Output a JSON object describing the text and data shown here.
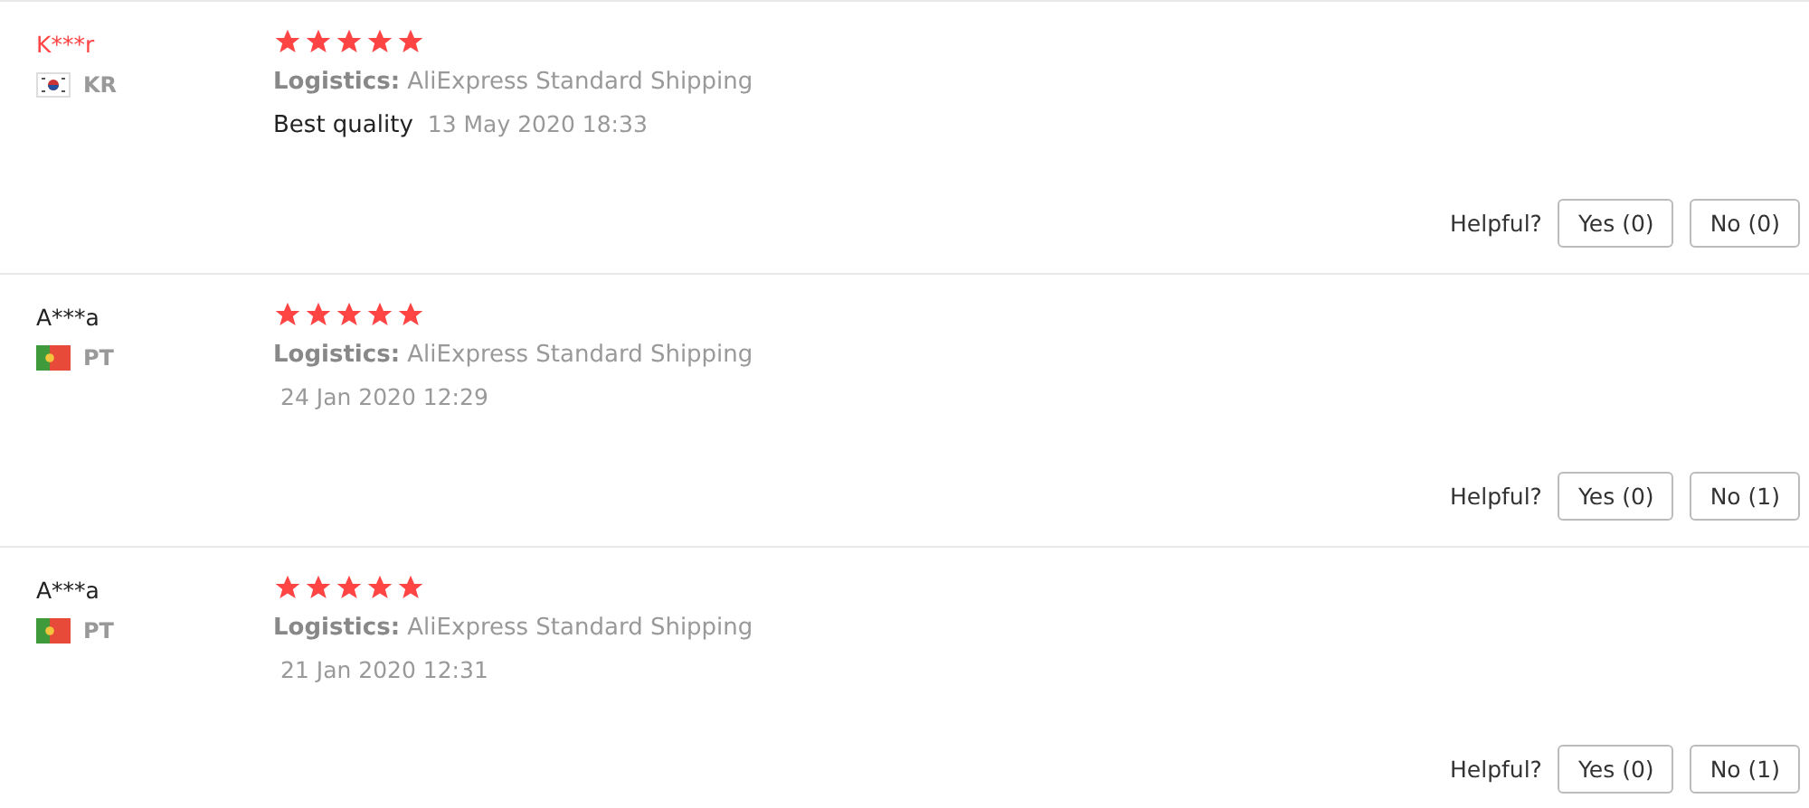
{
  "reviews": [
    {
      "name": "K***r",
      "highlighted": true,
      "country": "KR",
      "stars": 5,
      "logistics": "**Logistics:** AliExpress Standard Shipping",
      "comment": "Best quality",
      "date": "13 May 2020 18:33",
      "helpful_label": "Helpful?",
      "yes": "Yes (0)",
      "no": "No (0)"
    },
    {
      "name": "A***a",
      "highlighted": false,
      "country": "PT",
      "stars": 5,
      "logistics": "**Logistics:** AliExpress Standard Shipping",
      "date": "24 Jan 2020 12:29",
      "helpful_label": "Helpful?",
      "yes": "Yes (0)",
      "no": "No (1)"
    },
    {
      "name": "A***a",
      "highlighted": false,
      "country": "PT",
      "stars": 5,
      "logistics": "**Logistics:** AliExpress Standard Shipping",
      "date": "21 Jan 2020 12:31",
      "helpful_label": "Helpful?",
      "yes": "Yes (0)",
      "no": "No (1)"
    }
  ]
}
